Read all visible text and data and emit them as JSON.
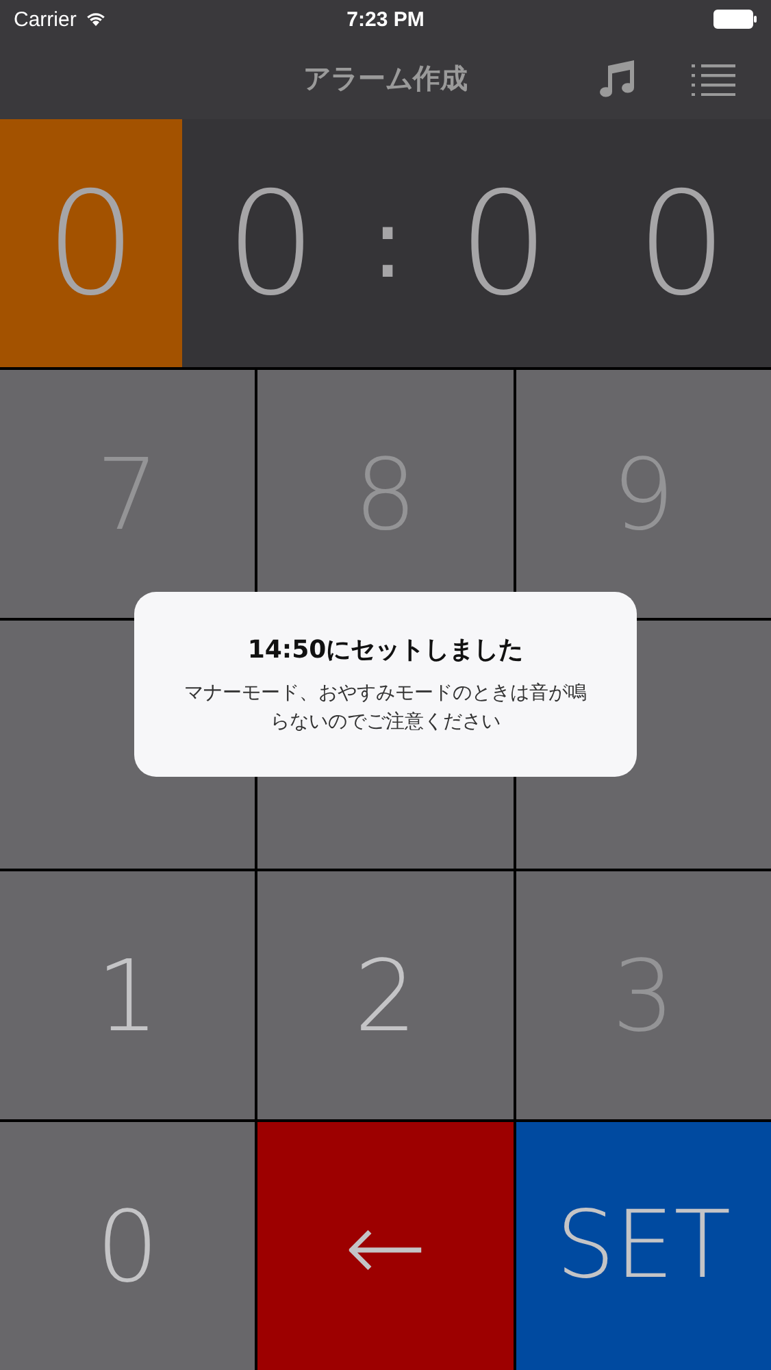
{
  "status_bar": {
    "carrier": "Carrier",
    "time": "7:23 PM"
  },
  "nav": {
    "title": "アラーム作成"
  },
  "display": {
    "digits": [
      {
        "value": "0",
        "selected": true
      },
      {
        "value": "0",
        "selected": false
      },
      {
        "value": "0",
        "selected": false
      },
      {
        "value": "0",
        "selected": false
      }
    ],
    "separator": ":"
  },
  "keypad": [
    {
      "kind": "digit",
      "label": "7",
      "disabled": true
    },
    {
      "kind": "digit",
      "label": "8",
      "disabled": true
    },
    {
      "kind": "digit",
      "label": "9",
      "disabled": true
    },
    {
      "kind": "digit"
    },
    {
      "kind": "digit"
    },
    {
      "kind": "digit"
    },
    {
      "kind": "digit",
      "label": "1",
      "disabled": false
    },
    {
      "kind": "digit",
      "label": "2",
      "disabled": false
    },
    {
      "kind": "digit",
      "label": "3",
      "disabled": true
    },
    {
      "kind": "digit",
      "label": "0",
      "disabled": false
    },
    {
      "kind": "delete",
      "label": "←",
      "disabled": false
    },
    {
      "kind": "set",
      "label": "SET",
      "disabled": false
    }
  ],
  "toast": {
    "title": "14:50にセットしました",
    "message": "マナーモード、おやすみモードのときは音が鳴らないのでご注意ください"
  }
}
